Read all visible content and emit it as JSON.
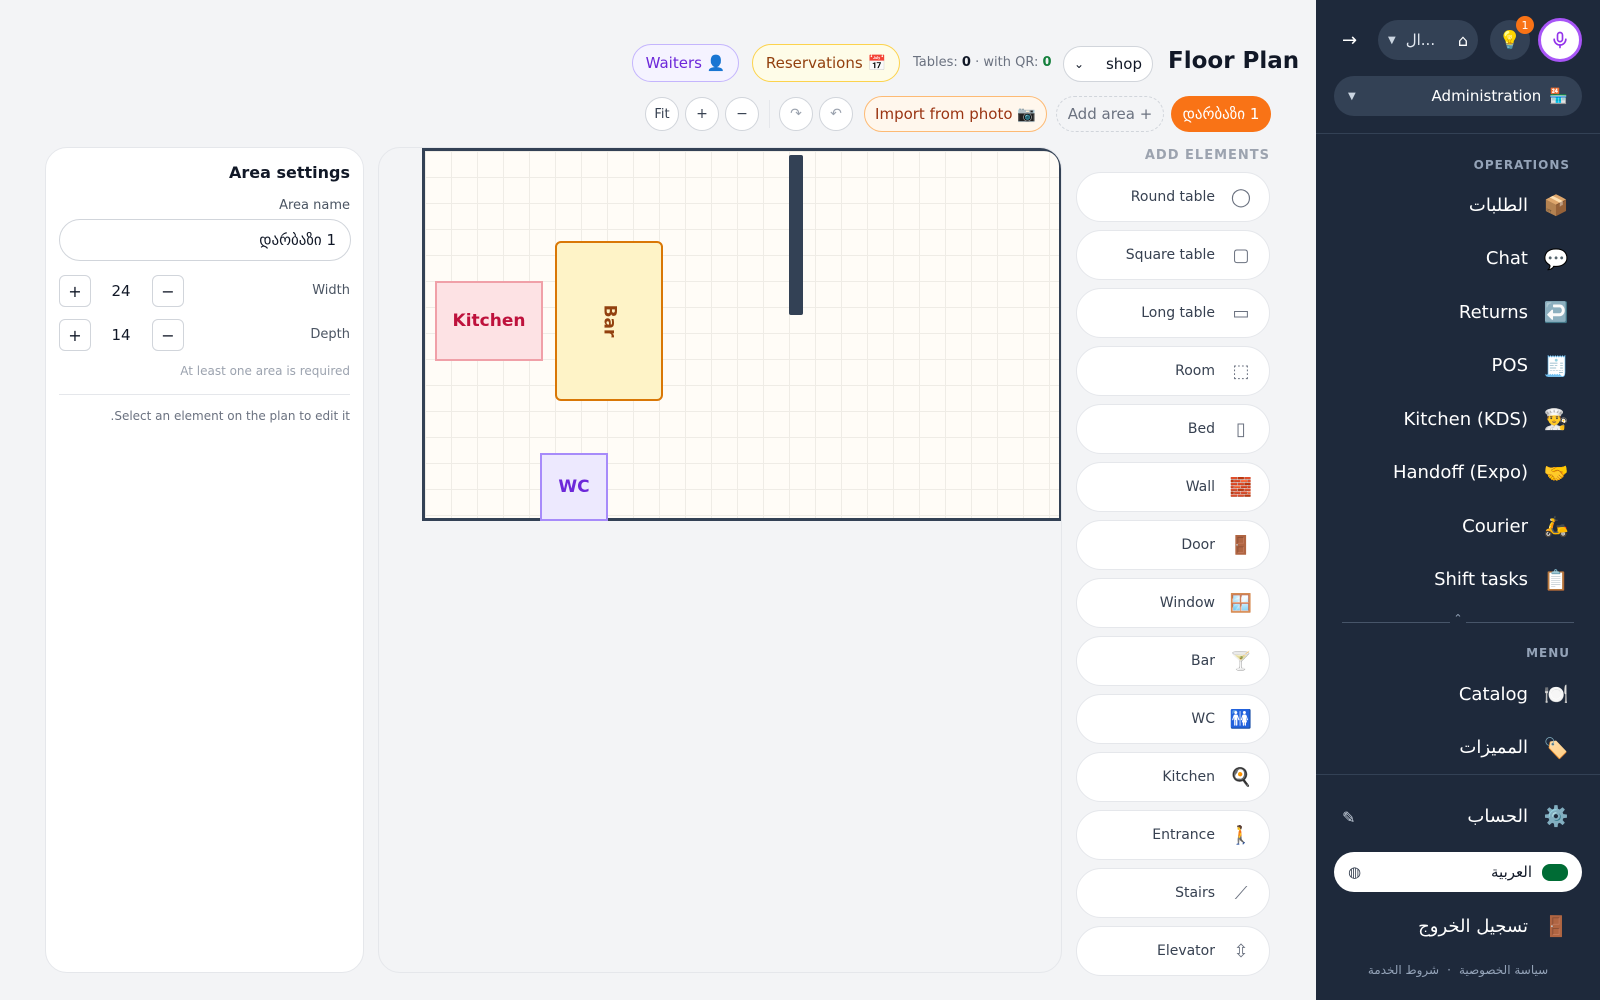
{
  "header": {
    "title": "Floor Plan",
    "shop_select": "shop",
    "tables_label": "Tables:",
    "tables_count": "0",
    "qr_label": "· with QR:",
    "qr_count": "0",
    "reservations": "Reservations 📅",
    "waiters": "Waiters 👤",
    "area_tab": "დარბაზი 1",
    "add_area": "Add area +",
    "import_photo": "Import from photo 📷",
    "undo": "↶",
    "redo": "↷",
    "zoom_out": "−",
    "zoom_in": "+",
    "fit": "Fit"
  },
  "area_settings": {
    "title": "Area settings",
    "name_label": "Area name",
    "name_value": "დარბაზი 1",
    "width_label": "Width",
    "width_value": "24",
    "depth_label": "Depth",
    "depth_value": "14",
    "plus": "+",
    "minus": "−",
    "required_note": "At least one area is required",
    "hint": "Select an element on the plan to edit it."
  },
  "plan": {
    "kitchen": "Kitchen",
    "bar": "Bar",
    "wc": "WC"
  },
  "elements": {
    "heading": "ADD ELEMENTS",
    "items": [
      {
        "label": "Round table",
        "icon": "◯"
      },
      {
        "label": "Square table",
        "icon": "▢"
      },
      {
        "label": "Long table",
        "icon": "▭"
      },
      {
        "label": "Room",
        "icon": "⬚"
      },
      {
        "label": "Bed",
        "icon": "▯"
      },
      {
        "label": "Wall",
        "icon": "🧱"
      },
      {
        "label": "Door",
        "icon": "🚪"
      },
      {
        "label": "Window",
        "icon": "🪟"
      },
      {
        "label": "Bar",
        "icon": "🍸"
      },
      {
        "label": "WC",
        "icon": "🚻"
      },
      {
        "label": "Kitchen",
        "icon": "🍳"
      },
      {
        "label": "Entrance",
        "icon": "🚶"
      },
      {
        "label": "Stairs",
        "icon": "⟋"
      },
      {
        "label": "Elevator",
        "icon": "⇳"
      }
    ]
  },
  "sidebar": {
    "collapse": "→",
    "store_selector": "ال...",
    "notification_count": "1",
    "role": "Administration",
    "role_icon": "🏪",
    "operations_heading": "OPERATIONS",
    "operations": [
      {
        "label": "الطلبات",
        "icon": "📦"
      },
      {
        "label": "Chat",
        "icon": "💬"
      },
      {
        "label": "Returns",
        "icon": "↩️"
      },
      {
        "label": "POS",
        "icon": "🧾"
      },
      {
        "label": "Kitchen (KDS)",
        "icon": "👨‍🍳"
      },
      {
        "label": "Handoff (Expo)",
        "icon": "🤝"
      },
      {
        "label": "Courier",
        "icon": "🛵"
      },
      {
        "label": "Shift tasks",
        "icon": "📋"
      }
    ],
    "menu_heading": "MENU",
    "menu": [
      {
        "label": "Catalog",
        "icon": "🍽️"
      },
      {
        "label": "المميزات",
        "icon": "🏷️"
      }
    ],
    "account": "الحساب",
    "account_icon": "⚙️",
    "language": "العربية",
    "logout": "تسجيل الخروج",
    "logout_icon": "🚪",
    "privacy": "سياسة الخصوصية",
    "terms": "شروط الخدمة",
    "separator": "·"
  },
  "colors": {
    "accent": "#f97316",
    "sidebar_bg": "#1e293b",
    "kitchen_fill": "#fde2e4",
    "bar_fill": "#fef3c7",
    "wc_fill": "#ede9fe",
    "mic_ring": "#a855f7"
  }
}
